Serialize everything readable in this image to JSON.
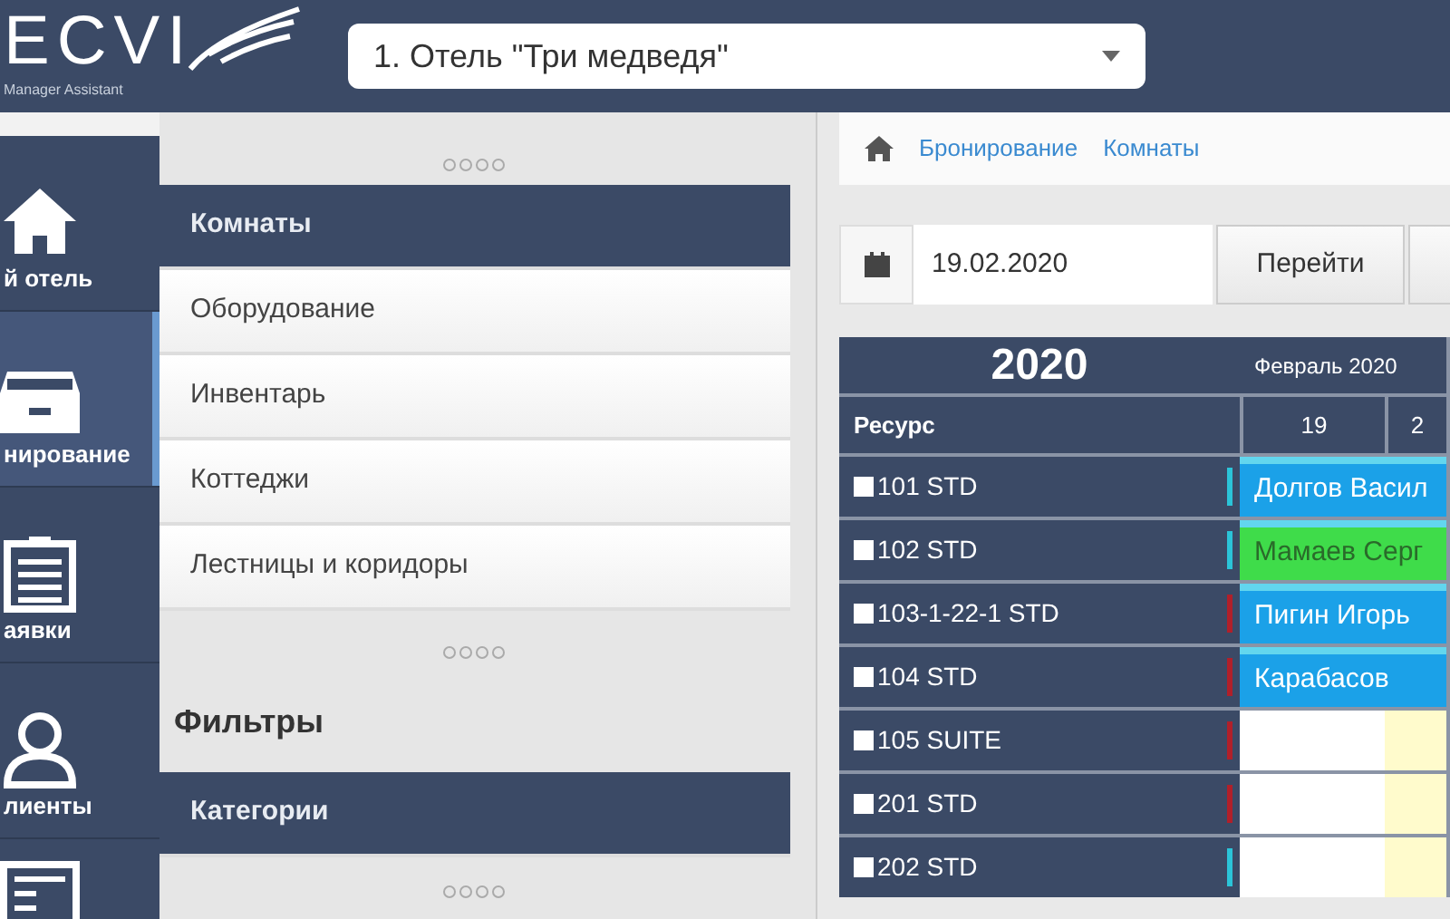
{
  "header": {
    "logo_text": "ECVI",
    "logo_subtitle": "Manager Assistant",
    "hotel_select": "1. Отель \"Три медведя\""
  },
  "nav": [
    {
      "label": "й отель",
      "selected": false
    },
    {
      "label": "нирование",
      "selected": true
    },
    {
      "label": "аявки",
      "selected": false
    },
    {
      "label": "лиенты",
      "selected": false
    },
    {
      "selected": false
    }
  ],
  "menu": {
    "items": [
      {
        "label": "Комнаты",
        "selected": true
      },
      {
        "label": "Оборудование",
        "selected": false
      },
      {
        "label": "Инвентарь",
        "selected": false
      },
      {
        "label": "Коттеджи",
        "selected": false
      },
      {
        "label": "Лестницы и коридоры",
        "selected": false
      }
    ],
    "filters_title": "Фильтры",
    "filters": [
      {
        "label": "Категории",
        "selected": true
      }
    ]
  },
  "breadcrumb": [
    "Бронирование",
    "Комнаты"
  ],
  "date_field": {
    "value": "19.02.2020"
  },
  "go_button": "Перейти",
  "grid": {
    "year": "2020",
    "month": "Февраль 2020",
    "resource_header": "Ресурс",
    "days": [
      "19",
      "2"
    ],
    "rows": [
      {
        "name": "101 STD",
        "checked": false,
        "color": "#2bc4d8",
        "booking": {
          "guest": "Долгов Васил",
          "color": "#1ba1e8"
        }
      },
      {
        "name": "102 STD",
        "checked": false,
        "color": "#2bc4d8",
        "booking": {
          "guest": "Мамаев Серг",
          "color": "#3fdc4a"
        }
      },
      {
        "name": "103-1-22-1 STD",
        "checked": false,
        "color": "#b0202a",
        "booking": {
          "guest": "Пигин Игорь",
          "color": "#1ba1e8"
        }
      },
      {
        "name": "104 STD",
        "checked": false,
        "color": "#b0202a",
        "booking": {
          "guest": "Карабасов",
          "color": "#1ba1e8"
        }
      },
      {
        "name": "105 SUITE",
        "checked": false,
        "color": "#b0202a"
      },
      {
        "name": "201 STD",
        "checked": false,
        "color": "#b0202a"
      },
      {
        "name": "202 STD",
        "checked": false,
        "color": "#2bc4d8"
      }
    ]
  }
}
